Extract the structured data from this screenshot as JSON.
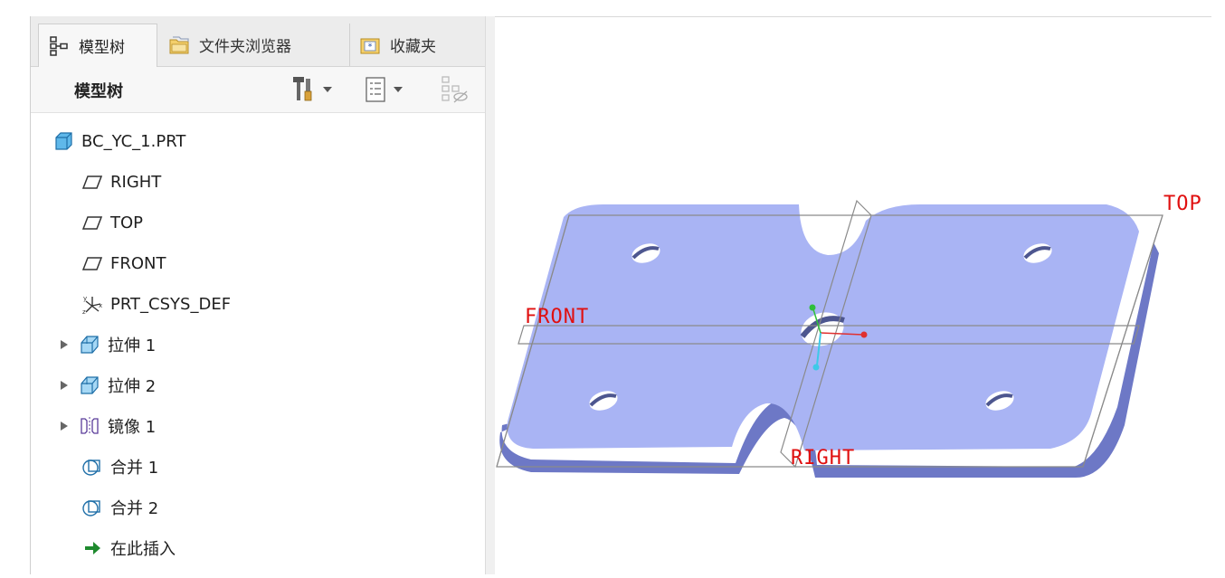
{
  "tabs": [
    {
      "label": "模型树",
      "icon": "model-tree-icon",
      "active": true
    },
    {
      "label": "文件夹浏览器",
      "icon": "folder-browser-icon",
      "active": false
    },
    {
      "label": "收藏夹",
      "icon": "favorites-icon",
      "active": false
    }
  ],
  "toolbar": {
    "title": "模型树",
    "tools": [
      "settings-tools-icon",
      "tree-filter-icon",
      "show-hide-icon"
    ]
  },
  "tree": {
    "items": [
      {
        "label": "BC_YC_1.PRT",
        "icon": "part-icon",
        "expandable": false,
        "level": 0
      },
      {
        "label": "RIGHT",
        "icon": "datum-plane-icon",
        "expandable": false,
        "level": 1
      },
      {
        "label": "TOP",
        "icon": "datum-plane-icon",
        "expandable": false,
        "level": 1
      },
      {
        "label": "FRONT",
        "icon": "datum-plane-icon",
        "expandable": false,
        "level": 1
      },
      {
        "label": "PRT_CSYS_DEF",
        "icon": "coordinate-system-icon",
        "expandable": false,
        "level": 1
      },
      {
        "label": "拉伸 1",
        "icon": "extrude-icon",
        "expandable": true,
        "level": 1
      },
      {
        "label": "拉伸 2",
        "icon": "extrude-icon",
        "expandable": true,
        "level": 1
      },
      {
        "label": "镜像 1",
        "icon": "mirror-icon",
        "expandable": true,
        "level": 1
      },
      {
        "label": "合并 1",
        "icon": "merge-icon",
        "expandable": false,
        "level": 1
      },
      {
        "label": "合并 2",
        "icon": "merge-icon",
        "expandable": false,
        "level": 1
      },
      {
        "label": "在此插入",
        "icon": "insert-here-icon",
        "expandable": false,
        "level": 1
      }
    ]
  },
  "viewport": {
    "datum_labels": {
      "top": "TOP",
      "front": "FRONT",
      "right": "RIGHT"
    },
    "colors": {
      "part_face": "#a9b4f4",
      "part_side": "#6d78c6",
      "datum_red": "#e01010",
      "plane_gray": "#8a8a8a"
    }
  }
}
